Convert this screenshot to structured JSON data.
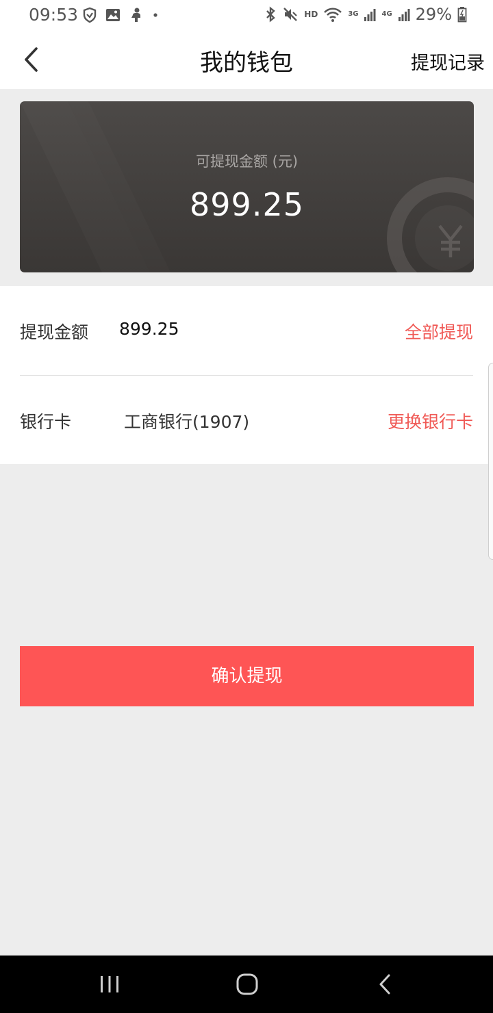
{
  "status_bar": {
    "time": "09:53",
    "battery": "29%",
    "hd": "HD",
    "net_3g": "3G",
    "net_4g": "4G",
    "icons": [
      "shield-icon",
      "image-icon",
      "person-icon",
      "dot-icon",
      "bluetooth-icon",
      "mute-icon",
      "wifi-icon",
      "signal-icon",
      "battery-icon"
    ]
  },
  "nav": {
    "title": "我的钱包",
    "action": "提现记录"
  },
  "balance_card": {
    "label": "可提现金额 (元)",
    "amount": "899.25"
  },
  "form": {
    "amount_row": {
      "label": "提现金额",
      "value": "899.25",
      "action": "全部提现"
    },
    "bank_row": {
      "label": "银行卡",
      "value": "工商银行(1907)",
      "action": "更换银行卡"
    }
  },
  "confirm_button": "确认提现",
  "colors": {
    "accent": "#fe5555",
    "accent_text": "#f05a56",
    "card_bg": "#403d3b",
    "page_bg": "#ededed"
  }
}
